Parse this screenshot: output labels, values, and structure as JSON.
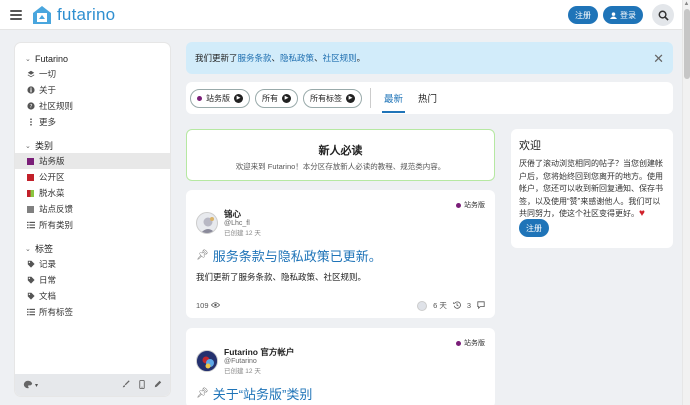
{
  "header": {
    "logo_text": "futarino",
    "signup_label": "注册",
    "login_label": "登录"
  },
  "sidebar": {
    "site_section": "Futarino",
    "site_items": [
      {
        "label": "一切",
        "icon": "layers-icon"
      },
      {
        "label": "关于",
        "icon": "info-icon"
      },
      {
        "label": "社区规则",
        "icon": "question-icon"
      },
      {
        "label": "更多",
        "icon": "more-icon"
      }
    ],
    "categories_section": "类别",
    "categories": [
      {
        "label": "站务版",
        "color": "#7a1e78"
      },
      {
        "label": "公开区",
        "color": "#c2202a"
      },
      {
        "label": "脱水菜",
        "color": "#8bc53f"
      },
      {
        "label": "站点反馈",
        "color": "#808080"
      },
      {
        "label": "所有类别",
        "icon": "list-icon"
      }
    ],
    "tags_section": "标签",
    "tags": [
      {
        "label": "记录",
        "icon": "tag-icon"
      },
      {
        "label": "日常",
        "icon": "tag-icon"
      },
      {
        "label": "文档",
        "icon": "tag-icon"
      },
      {
        "label": "所有标签",
        "icon": "list-icon"
      }
    ]
  },
  "notice": {
    "prefix": "我们更新了",
    "link1": "服务条款",
    "sep1": "、",
    "link2": "隐私政策",
    "sep2": "、",
    "link3": "社区规则",
    "suffix": "。"
  },
  "filters": {
    "category": "站务版",
    "tags_a": "所有",
    "tags_b": "所有标签",
    "tab_latest": "最新",
    "tab_hot": "热门"
  },
  "must_read": {
    "title": "新人必读",
    "subtitle": "欢迎来到 Futarino！本分区存放新人必读的教程、规范类内容。"
  },
  "posts": [
    {
      "tag": "站务版",
      "author": "锦心",
      "handle": "@Lhc_fl",
      "time": "已创建 12 天",
      "title": "服务条款与隐私政策已更新。",
      "excerpt": "我们更新了服务条款、隐私政策、社区规则。",
      "views": "109",
      "age": "6 天",
      "replies": "3"
    },
    {
      "tag": "站务版",
      "author": "Futarino 官方帐户",
      "handle": "@Futarino",
      "time": "已创建 12 天",
      "title": "关于“站务版”类别"
    }
  ],
  "welcome": {
    "title": "欢迎",
    "body": "厌倦了滚动浏览相同的帖子？当您创建帐户后，您将始终回到您离开的地方。使用帐户，您还可以收到新回复通知、保存书签，以及使用“赞”来感谢他人。我们可以共同努力，使这个社区变得更好。",
    "button": "注册"
  }
}
